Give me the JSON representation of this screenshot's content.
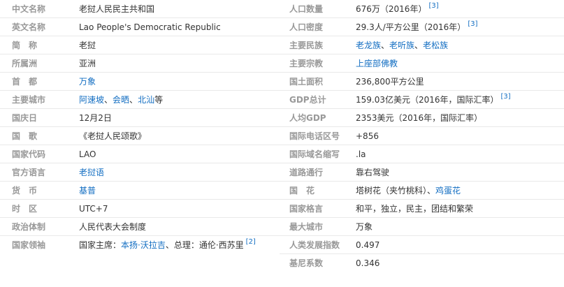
{
  "left_rows": [
    {
      "label": "中文名称",
      "value": "老挝人民民主共和国"
    },
    {
      "label": "英文名称",
      "value": "Lao People's Democratic Republic"
    },
    {
      "label": "简　称",
      "value": "老挝"
    },
    {
      "label": "所属洲",
      "value": "亚洲"
    },
    {
      "label": "首　都",
      "link": "万象"
    },
    {
      "label": "主要城市",
      "links": [
        "阿速坡",
        "会晒",
        "北汕"
      ],
      "suffix": "等"
    },
    {
      "label": "国庆日",
      "value": "12月2日"
    },
    {
      "label": "国　歌",
      "value": "《老挝人民颂歌》"
    },
    {
      "label": "国家代码",
      "value": "LAO"
    },
    {
      "label": "官方语言",
      "link": "老挝语"
    },
    {
      "label": "货　币",
      "link": "基普"
    },
    {
      "label": "时　区",
      "value": "UTC+7"
    },
    {
      "label": "政治体制",
      "value": "人民代表大会制度"
    },
    {
      "label": "国家领袖",
      "prefix": "国家主席：",
      "link": "本扬·沃拉吉",
      "mid": "、总理：通伦·西苏里",
      "ref": "[2]"
    }
  ],
  "right_rows": [
    {
      "label": "人口数量",
      "value": "676万（2016年）",
      "ref": "[3]"
    },
    {
      "label": "人口密度",
      "value": "29.3人/平方公里（2016年）",
      "ref": "[3]"
    },
    {
      "label": "主要民族",
      "links": [
        "老龙族",
        "老听族",
        "老松族"
      ]
    },
    {
      "label": "主要宗教",
      "link": "上座部佛教"
    },
    {
      "label": "国土面积",
      "value": "236,800平方公里"
    },
    {
      "label": "GDP总计",
      "value": "159.03亿美元（2016年，国际汇率）",
      "ref": "[3]"
    },
    {
      "label": "人均GDP",
      "value": "2353美元（2016年，国际汇率）"
    },
    {
      "label": "国际电话区号",
      "value": "+856"
    },
    {
      "label": "国际域名缩写",
      "value": ".la"
    },
    {
      "label": "道路通行",
      "value": "靠右驾驶"
    },
    {
      "label": "国　花",
      "value": "塔树花（夹竹桃科）、",
      "link": "鸡蛋花"
    },
    {
      "label": "国家格言",
      "value": "和平，独立，民主，团结和繁荣"
    },
    {
      "label": "最大城市",
      "value": "万象"
    },
    {
      "label": "人类发展指数",
      "value": "0.497"
    },
    {
      "label": "基尼系数",
      "value": "0.346"
    }
  ]
}
